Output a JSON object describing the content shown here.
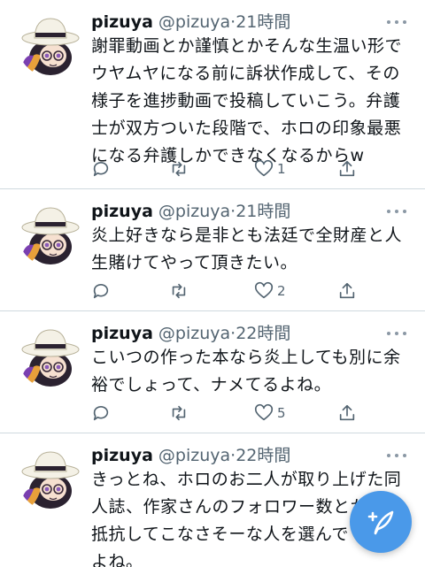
{
  "colors": {
    "accent": "#4a99e9",
    "text": "#0f1419",
    "muted": "#536471",
    "divider": "#cfd9de"
  },
  "tweets": [
    {
      "name": "pizuya",
      "handle": "@pizuya",
      "time": "·21時間",
      "lines": [
        "謝罪動画とか謹慎とかそんな生温い形で",
        "ウヤムヤになる前に訴状作成して、その",
        "様子を進捗動画で投稿していこう。弁護",
        "士が双方ついた段階で、ホロの印象最悪",
        "になる弁護しかできなくなるからw"
      ],
      "likes": "1"
    },
    {
      "name": "pizuya",
      "handle": "@pizuya",
      "time": "·21時間",
      "lines": [
        "炎上好きなら是非とも法廷で全財産と人",
        "生賭けてやって頂きたい。"
      ],
      "likes": "2"
    },
    {
      "name": "pizuya",
      "handle": "@pizuya",
      "time": "·22時間",
      "lines": [
        "こいつの作った本なら炎上しても別に余",
        "裕でしょって、ナメてるよね。"
      ],
      "likes": "5"
    },
    {
      "name": "pizuya",
      "handle": "@pizuya",
      "time": "·22時間",
      "lines": [
        "きっとね、ホロのお二人が取り上げた同",
        "人誌、作家さんのフォロワー数とか",
        "抵抗してこなさそーな人を選んで",
        "よね。"
      ],
      "likes": ""
    }
  ],
  "icons": {
    "reply": "reply-icon",
    "retweet": "retweet-icon",
    "like": "like-icon",
    "share": "share-icon",
    "more": "more-icon",
    "compose": "compose-icon"
  }
}
